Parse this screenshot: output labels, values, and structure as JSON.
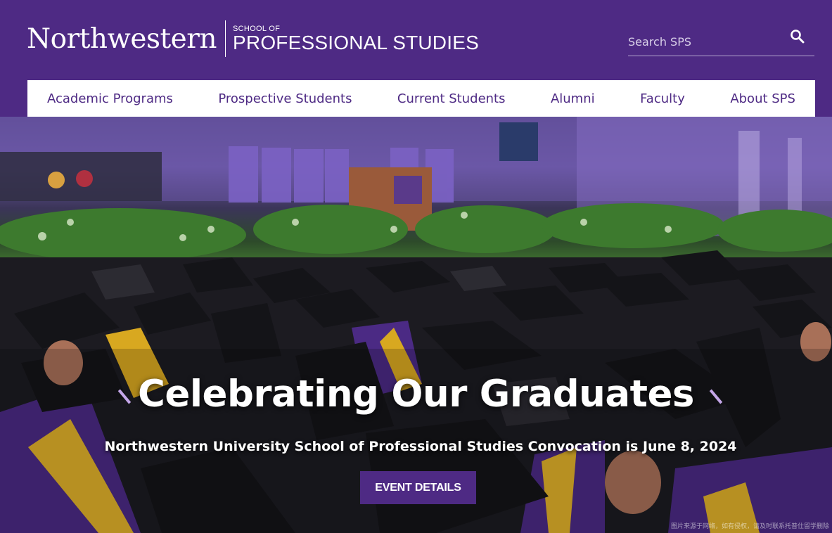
{
  "header": {
    "logo_university": "Northwestern",
    "logo_school_small": "SCHOOL OF",
    "logo_school_big": "PROFESSIONAL STUDIES",
    "search_placeholder": "Search SPS",
    "search_icon": "search-icon"
  },
  "nav": {
    "items": [
      {
        "label": "Academic Programs"
      },
      {
        "label": "Prospective Students"
      },
      {
        "label": "Current Students"
      },
      {
        "label": "Alumni"
      },
      {
        "label": "Faculty"
      },
      {
        "label": "About SPS"
      }
    ]
  },
  "hero": {
    "title": "Celebrating Our Graduates",
    "subtitle": "Northwestern University School of Professional Studies Convocation is June 8, 2024",
    "button_label": "EVENT DETAILS",
    "watermark": "图片来源于网络，如有侵权，请及时联系托普仕留学删除"
  },
  "colors": {
    "brand_purple": "#4e2a84",
    "white": "#ffffff"
  }
}
